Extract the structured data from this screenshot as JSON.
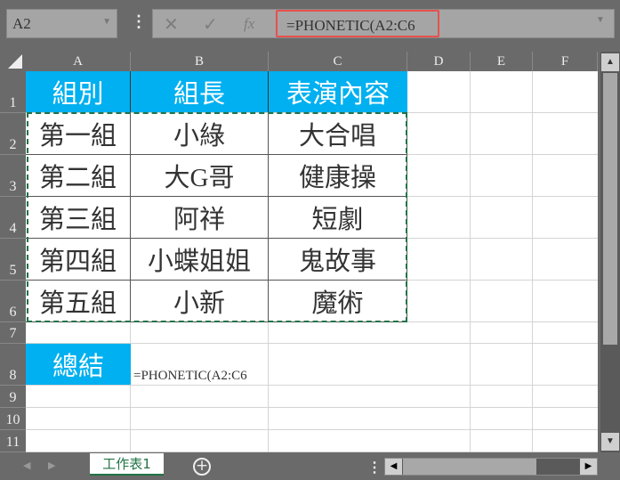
{
  "name_box": "A2",
  "formula_bar": {
    "cancel": "✕",
    "enter": "✓",
    "fx": "fx",
    "formula": "=PHONETIC(A2:C6"
  },
  "columns": [
    "A",
    "B",
    "C",
    "D",
    "E",
    "F"
  ],
  "rows": [
    "1",
    "2",
    "3",
    "4",
    "5",
    "6",
    "7",
    "8",
    "9",
    "10",
    "11"
  ],
  "header": [
    "組別",
    "組長",
    "表演內容"
  ],
  "data": [
    [
      "第一組",
      "小綠",
      "大合唱"
    ],
    [
      "第二組",
      "大G哥",
      "健康操"
    ],
    [
      "第三組",
      "阿祥",
      "短劇"
    ],
    [
      "第四組",
      "小蝶姐姐",
      "鬼故事"
    ],
    [
      "第五組",
      "小新",
      "魔術"
    ]
  ],
  "summary_label": "總結",
  "summary_value": "=PHONETIC(A2:C6",
  "sheet_tab": "工作表1",
  "add_sheet": "+",
  "colors": {
    "header_fill": "#00b0f0",
    "highlight": "#e8504d",
    "marquee": "#217346"
  }
}
